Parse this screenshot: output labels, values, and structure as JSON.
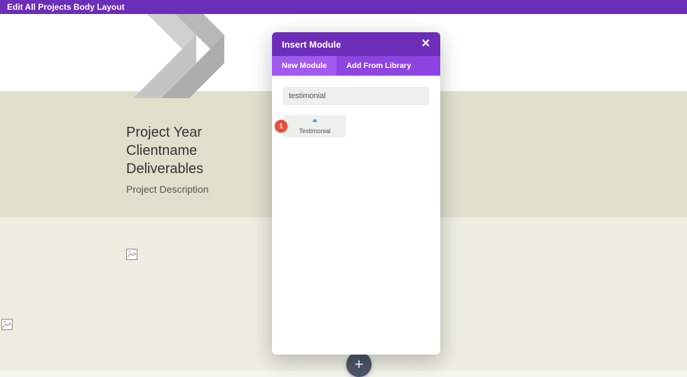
{
  "topbar": {
    "title": "Edit All Projects Body Layout"
  },
  "textblock": {
    "line1": "Project Year",
    "line2": "Clientname",
    "line3": "Deliverables",
    "desc": "Project Description"
  },
  "modal": {
    "title": "Insert Module",
    "close": "✕",
    "tabs": {
      "new": "New Module",
      "library": "Add From Library"
    },
    "search_value": "testimonial",
    "module": {
      "icon": "❝",
      "label": "Testimonial"
    },
    "annotation": "1"
  },
  "fab": {
    "plus": "+"
  }
}
